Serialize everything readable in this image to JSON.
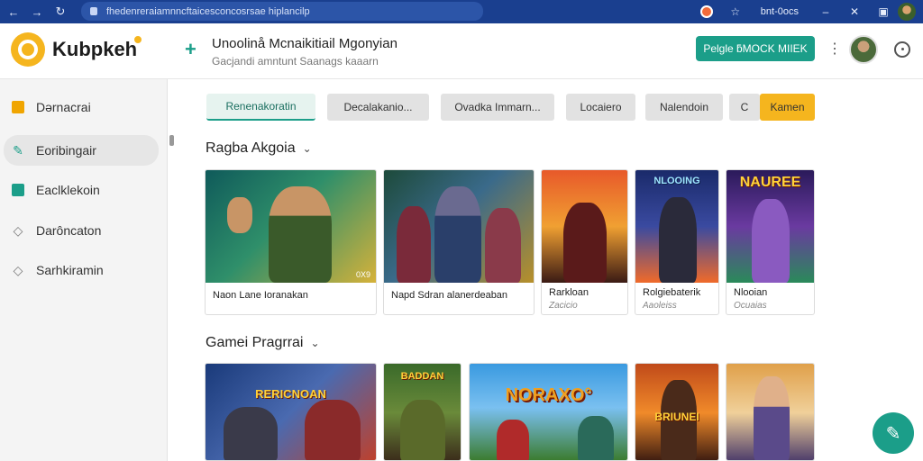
{
  "browser": {
    "url": "fhedenreraiamnncftaicesconcosrsae hiplancilp",
    "right_label": "bnt-0ocs",
    "icons": [
      "back-icon",
      "forward-icon",
      "reload-icon",
      "lock-icon",
      "star-icon",
      "minimize-icon",
      "close-icon",
      "camera-icon"
    ]
  },
  "header": {
    "brand": "Kubpkeh",
    "title": "Unoolinå Mcnaikitiail Mgonyian",
    "subtitle": "Gacjandi amntunt Saanags kaaarn",
    "primary_button": "Pelgle ƃMOCK MIIEK",
    "accent_color": "#1b9e89",
    "brand_color": "#f5b51e"
  },
  "sidebar": {
    "items": [
      {
        "label": "Dərnacrai",
        "icon": "folder-icon"
      },
      {
        "label": "Eoribingair",
        "icon": "edit-icon"
      },
      {
        "label": "Eaclklekoin",
        "icon": "checkbox-icon"
      },
      {
        "label": "Darôncaton",
        "icon": "tag-icon"
      },
      {
        "label": "Sarhkiramin",
        "icon": "tag-icon"
      }
    ]
  },
  "filters": [
    {
      "label": "Renenakoratin",
      "state": "selected"
    },
    {
      "label": "Decalakanio..."
    },
    {
      "label": "Ovadka Immarn..."
    },
    {
      "label": "Locaiero"
    },
    {
      "label": "Nalendoin"
    },
    {
      "label": "C"
    },
    {
      "label": "Kamen",
      "state": "accent"
    }
  ],
  "sections": [
    {
      "title": "Ragba Akgoia",
      "cards": [
        {
          "title": "Naon Lane Ioranakan",
          "subtitle": "",
          "art_text": "",
          "badge": "0X9"
        },
        {
          "title": "Napd Sdran alanerdeaban",
          "subtitle": "",
          "art_text": "",
          "badge": ""
        },
        {
          "title": "Rarkloan",
          "subtitle": "Zacicio",
          "art_text": "",
          "badge": ""
        },
        {
          "title": "Rolgiebaterik",
          "subtitle": "Aaoleiss",
          "art_text": "NLOOING",
          "badge": ""
        },
        {
          "title": "Nlooian",
          "subtitle": "Ocuaias",
          "art_text": "NAUREE",
          "badge": ""
        }
      ]
    },
    {
      "title": "Gamei Pragrrai",
      "cards": [
        {
          "art_text": "RERICNOAN"
        },
        {
          "art_text": "BADDAN"
        },
        {
          "art_text": "NORAXO°"
        },
        {
          "art_text": "BRIUNEI"
        },
        {
          "art_text": ""
        }
      ]
    }
  ]
}
